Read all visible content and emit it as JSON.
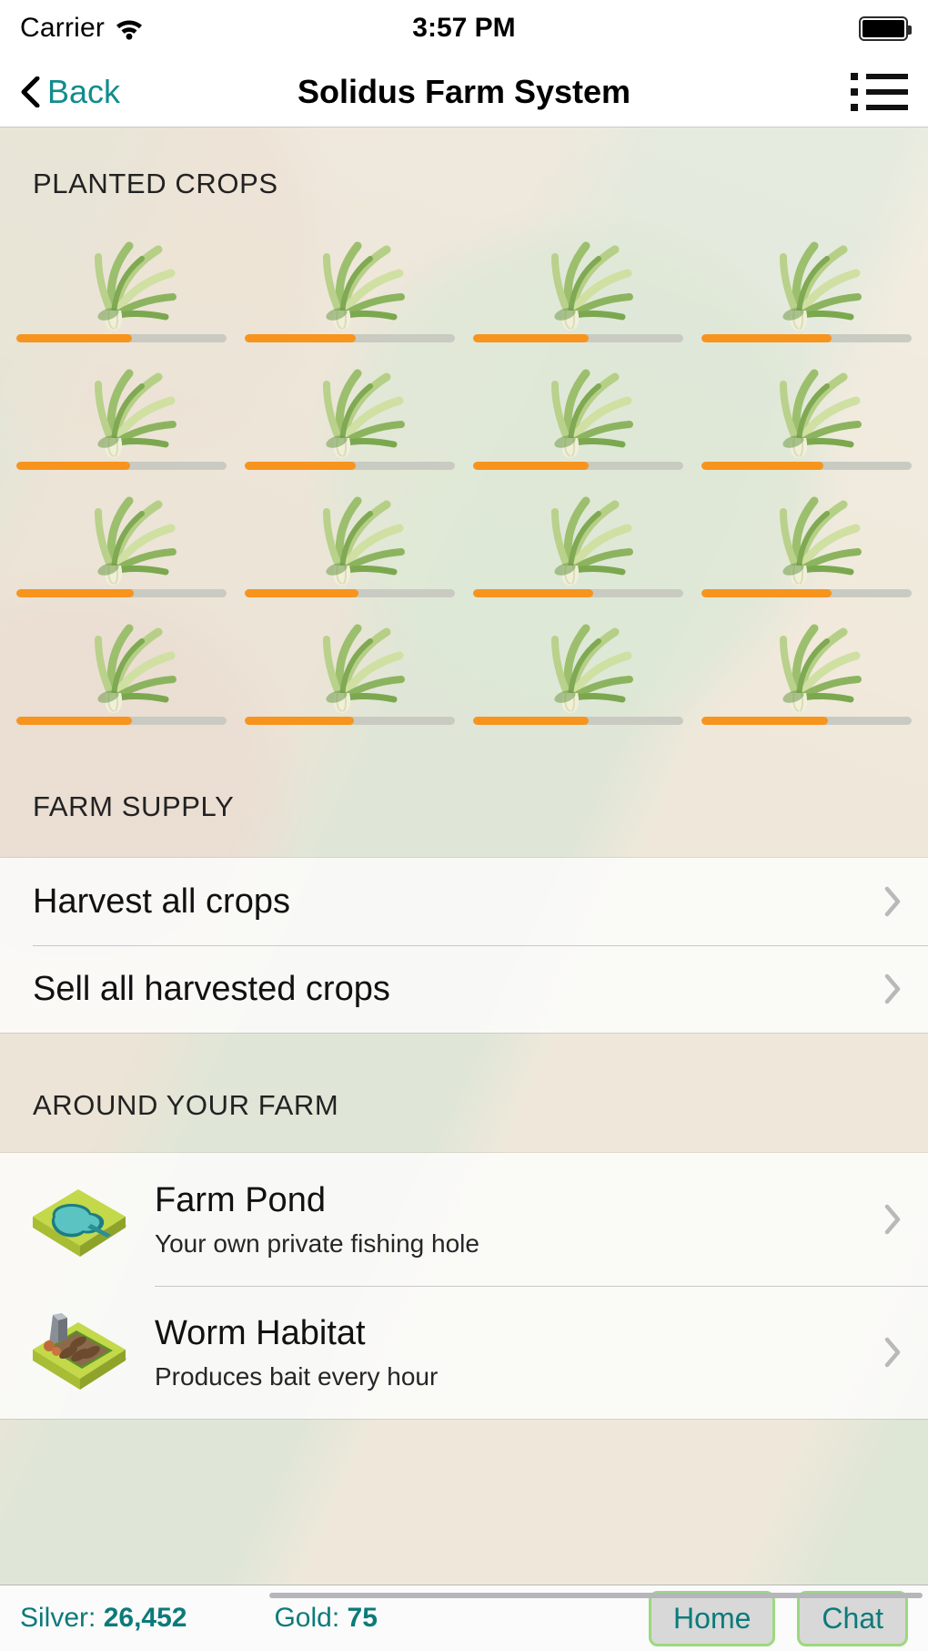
{
  "status_bar": {
    "carrier": "Carrier",
    "wifi_icon": "wifi-icon",
    "time": "3:57 PM",
    "battery_icon": "battery-full-icon"
  },
  "nav_bar": {
    "back_label": "Back",
    "back_icon": "chevron-left-icon",
    "title": "Solidus Farm System",
    "menu_icon": "list-menu-icon"
  },
  "planted_crops": {
    "header": "PLANTED CROPS",
    "crop_icon": "scallion-crop-icon",
    "cells": [
      {
        "progress": 55
      },
      {
        "progress": 53
      },
      {
        "progress": 55
      },
      {
        "progress": 62
      },
      {
        "progress": 54
      },
      {
        "progress": 53
      },
      {
        "progress": 55
      },
      {
        "progress": 58
      },
      {
        "progress": 56
      },
      {
        "progress": 54
      },
      {
        "progress": 57
      },
      {
        "progress": 62
      },
      {
        "progress": 55
      },
      {
        "progress": 52
      },
      {
        "progress": 55
      },
      {
        "progress": 60
      }
    ]
  },
  "farm_supply": {
    "header": "FARM SUPPLY",
    "rows": [
      {
        "label": "Harvest all crops",
        "chevron": "chevron-right-icon"
      },
      {
        "label": "Sell all harvested crops",
        "chevron": "chevron-right-icon"
      }
    ]
  },
  "around_your_farm": {
    "header": "AROUND YOUR FARM",
    "rows": [
      {
        "icon": "farm-pond-icon",
        "name": "Farm Pond",
        "description": "Your own private fishing hole",
        "chevron": "chevron-right-icon"
      },
      {
        "icon": "worm-habitat-icon",
        "name": "Worm Habitat",
        "description": "Produces bait every hour",
        "chevron": "chevron-right-icon"
      }
    ]
  },
  "bottom_bar": {
    "silver_label": "Silver:",
    "silver_value": "26,452",
    "gold_label": "Gold:",
    "gold_value": "75",
    "home_button": "Home",
    "chat_button": "Chat"
  },
  "colors": {
    "accent_teal": "#0c7a7a",
    "progress_fill": "#f7941e",
    "progress_track": "#c9cbc2",
    "button_border_green": "#9bd97f",
    "bg_cream": "#ece4d6",
    "bg_green": "#dfe6d7"
  }
}
